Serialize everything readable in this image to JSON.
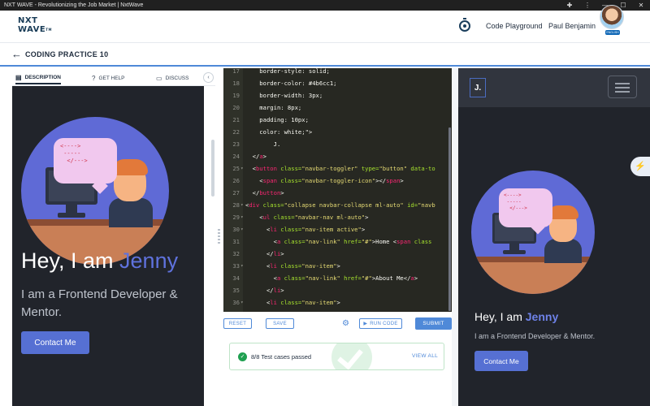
{
  "window": {
    "title": "NXT WAVE - Revolutionizing the Job Market | NxtWave"
  },
  "header": {
    "logo_line1": "NXT",
    "logo_line2": "WAVE",
    "logo_tm": "TM",
    "playground_label": "Code Playground",
    "user_name": "Paul Benjamin",
    "avatar_badge": "ENGLISH"
  },
  "subheader": {
    "title": "CODING PRACTICE 10"
  },
  "left_tabs": {
    "description": "DESCRIPTION",
    "get_help": "GET HELP",
    "discuss": "DISCUSS"
  },
  "description": {
    "bubble_code": "<---->\n -----\n  </--->",
    "title_prefix": "Hey, I am ",
    "title_name": "Jenny",
    "subtitle": "I am a Frontend Developer & Mentor.",
    "button": "Contact Me"
  },
  "editor": {
    "lines": [
      {
        "n": "17",
        "fold": "",
        "parts": [
          [
            "c-prop",
            "    border-style: solid;"
          ]
        ]
      },
      {
        "n": "18",
        "fold": "",
        "parts": [
          [
            "c-prop",
            "    border-color: #4b6cc1;"
          ]
        ]
      },
      {
        "n": "19",
        "fold": "",
        "parts": [
          [
            "c-prop",
            "    border-width: 3px;"
          ]
        ]
      },
      {
        "n": "20",
        "fold": "",
        "parts": [
          [
            "c-prop",
            "    margin: 8px;"
          ]
        ]
      },
      {
        "n": "21",
        "fold": "",
        "parts": [
          [
            "c-prop",
            "    padding: 10px;"
          ]
        ]
      },
      {
        "n": "22",
        "fold": "",
        "parts": [
          [
            "c-prop",
            "    color: white;\">"
          ]
        ]
      },
      {
        "n": "23",
        "fold": "",
        "parts": [
          [
            "c-plain",
            "        J."
          ]
        ]
      },
      {
        "n": "24",
        "fold": "",
        "parts": [
          [
            "c-plain",
            "  </"
          ],
          [
            "c-tag",
            "a"
          ],
          [
            "c-plain",
            ">"
          ]
        ]
      },
      {
        "n": "25",
        "fold": "▾",
        "parts": [
          [
            "c-plain",
            "  <"
          ],
          [
            "c-tag",
            "button"
          ],
          [
            "c-attr",
            " class="
          ],
          [
            "c-str",
            "\"navbar-toggler\""
          ],
          [
            "c-attr",
            " type="
          ],
          [
            "c-str",
            "\"button\""
          ],
          [
            "c-attr",
            " data-to"
          ]
        ]
      },
      {
        "n": "26",
        "fold": "",
        "parts": [
          [
            "c-plain",
            "    <"
          ],
          [
            "c-tag",
            "span"
          ],
          [
            "c-attr",
            " class="
          ],
          [
            "c-str",
            "\"navbar-toggler-icon\""
          ],
          [
            "c-plain",
            "></"
          ],
          [
            "c-tag",
            "span"
          ],
          [
            "c-plain",
            ">"
          ]
        ]
      },
      {
        "n": "27",
        "fold": "",
        "parts": [
          [
            "c-plain",
            "  </"
          ],
          [
            "c-tag",
            "button"
          ],
          [
            "c-plain",
            ">"
          ]
        ]
      },
      {
        "n": "28",
        "fold": "▾",
        "parts": [
          [
            "c-plain",
            "<"
          ],
          [
            "c-tag",
            "div"
          ],
          [
            "c-attr",
            " class="
          ],
          [
            "c-str",
            "\"collapse navbar-collapse ml-auto\""
          ],
          [
            "c-attr",
            " id="
          ],
          [
            "c-str",
            "\"navb"
          ]
        ]
      },
      {
        "n": "29",
        "fold": "▾",
        "parts": [
          [
            "c-plain",
            "    <"
          ],
          [
            "c-tag",
            "ul"
          ],
          [
            "c-attr",
            " class="
          ],
          [
            "c-str",
            "\"navbar-nav ml-auto\""
          ],
          [
            "c-plain",
            ">"
          ]
        ]
      },
      {
        "n": "30",
        "fold": "▾",
        "parts": [
          [
            "c-plain",
            "      <"
          ],
          [
            "c-tag",
            "li"
          ],
          [
            "c-attr",
            " class="
          ],
          [
            "c-str",
            "\"nav-item active\""
          ],
          [
            "c-plain",
            ">"
          ]
        ]
      },
      {
        "n": "31",
        "fold": "",
        "parts": [
          [
            "c-plain",
            "        <"
          ],
          [
            "c-tag",
            "a"
          ],
          [
            "c-attr",
            " class="
          ],
          [
            "c-str",
            "\"nav-link\""
          ],
          [
            "c-attr",
            " href="
          ],
          [
            "c-str",
            "\"#\""
          ],
          [
            "c-plain",
            ">Home <"
          ],
          [
            "c-tag",
            "span"
          ],
          [
            "c-attr",
            " class"
          ]
        ]
      },
      {
        "n": "32",
        "fold": "",
        "parts": [
          [
            "c-plain",
            "      </"
          ],
          [
            "c-tag",
            "li"
          ],
          [
            "c-plain",
            ">"
          ]
        ]
      },
      {
        "n": "33",
        "fold": "▾",
        "parts": [
          [
            "c-plain",
            "      <"
          ],
          [
            "c-tag",
            "li"
          ],
          [
            "c-attr",
            " class="
          ],
          [
            "c-str",
            "\"nav-item\""
          ],
          [
            "c-plain",
            ">"
          ]
        ]
      },
      {
        "n": "34",
        "fold": "",
        "parts": [
          [
            "c-plain",
            "        <"
          ],
          [
            "c-tag",
            "a"
          ],
          [
            "c-attr",
            " class="
          ],
          [
            "c-str",
            "\"nav-link\""
          ],
          [
            "c-attr",
            " href="
          ],
          [
            "c-str",
            "\"#\""
          ],
          [
            "c-plain",
            ">About Me</"
          ],
          [
            "c-tag",
            "a"
          ],
          [
            "c-plain",
            ">"
          ]
        ]
      },
      {
        "n": "35",
        "fold": "",
        "parts": [
          [
            "c-plain",
            "      </"
          ],
          [
            "c-tag",
            "li"
          ],
          [
            "c-plain",
            ">"
          ]
        ]
      },
      {
        "n": "36",
        "fold": "▾",
        "parts": [
          [
            "c-plain",
            "      <"
          ],
          [
            "c-tag",
            "li"
          ],
          [
            "c-attr",
            " class="
          ],
          [
            "c-str",
            "\"nav-item\""
          ],
          [
            "c-plain",
            ">"
          ]
        ]
      }
    ]
  },
  "toolbar": {
    "reset": "RESET",
    "save": "SAVE",
    "run_code": "RUN CODE",
    "submit": "SUBMIT"
  },
  "tests": {
    "result": "8/8 Test cases passed",
    "view_all": "VIEW ALL"
  },
  "preview": {
    "brand": "J.",
    "title_prefix": "Hey, I am ",
    "title_name": "Jenny",
    "subtitle": "I am a Frontend Developer & Mentor.",
    "button": "Contact Me"
  }
}
